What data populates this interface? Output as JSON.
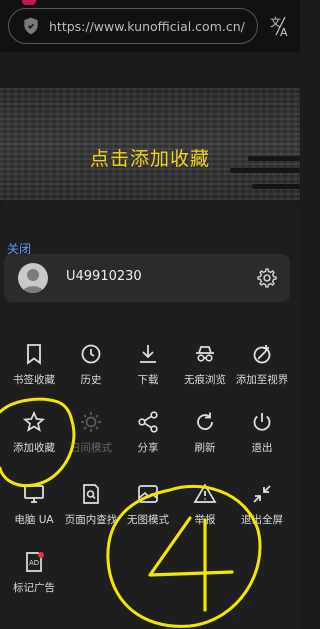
{
  "browser": {
    "url": "https://www.kunofficial.com.cn/",
    "translate_icon": "translate-icon",
    "security_icon": "shield-icon"
  },
  "page": {
    "heading": "点击添加收藏"
  },
  "menu": {
    "close_label": "关闭",
    "account": {
      "user_id": "U49910230"
    },
    "rows": [
      [
        {
          "label": "书签收藏",
          "icon": "bookmark-icon"
        },
        {
          "label": "历史",
          "icon": "history-icon"
        },
        {
          "label": "下载",
          "icon": "download-icon"
        },
        {
          "label": "无痕浏览",
          "icon": "incognito-icon"
        },
        {
          "label": "添加至视界",
          "icon": "add-to-view-icon"
        }
      ],
      [
        {
          "label": "添加收藏",
          "icon": "star-icon"
        },
        {
          "label": "日间模式",
          "icon": "sun-icon",
          "disabled": true
        },
        {
          "label": "分享",
          "icon": "share-icon"
        },
        {
          "label": "刷新",
          "icon": "refresh-icon"
        },
        {
          "label": "退出",
          "icon": "power-icon"
        }
      ],
      [
        {
          "label": "电脑 UA",
          "icon": "desktop-icon"
        },
        {
          "label": "页面内查找",
          "icon": "find-in-page-icon"
        },
        {
          "label": "无图模式",
          "icon": "no-image-icon"
        },
        {
          "label": "举报",
          "icon": "report-icon"
        },
        {
          "label": "退出全屏",
          "icon": "exit-fullscreen-icon"
        }
      ],
      [
        {
          "label": "标记广告",
          "icon": "ad-mark-icon"
        }
      ]
    ]
  },
  "colors": {
    "accent_blue": "#5aa0ff",
    "heading_yellow": "#f2d51a",
    "annotation_yellow": "#f5e600"
  }
}
